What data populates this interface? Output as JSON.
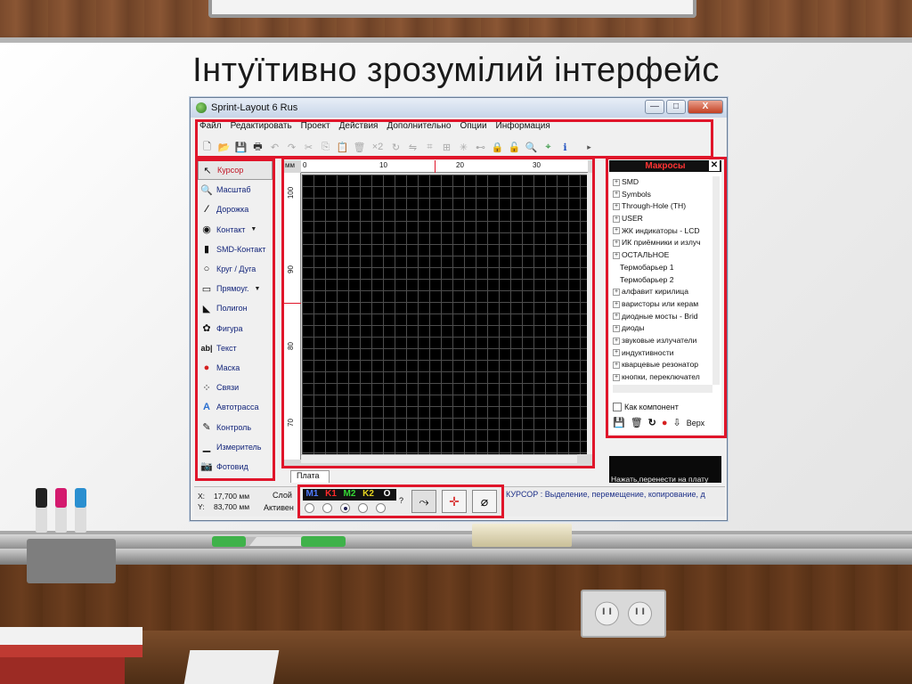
{
  "slide": {
    "title": "Інтуїтивно зрозумілий інтерфейс"
  },
  "window": {
    "title": "Sprint-Layout 6 Rus",
    "min_label": "—",
    "max_label": "□",
    "close_label": "X"
  },
  "menu": [
    "Файл",
    "Редактировать",
    "Проект",
    "Действия",
    "Дополнительно",
    "Опции",
    "Информация"
  ],
  "toolbar": {
    "new": "🗋",
    "open": "📂",
    "save": "💾",
    "print": "🖶",
    "undo": "↶",
    "redo": "↷",
    "cut": "✂",
    "copy": "⎘",
    "paste": "📋",
    "delete": "🗑",
    "x2": "×2",
    "rotate": "↻",
    "mirror": "⇋",
    "group": "⌗",
    "ungroup": "⊞",
    "light": "✳",
    "connect": "⊷",
    "lock": "🔒",
    "unlock": "🔓",
    "zoom": "🔍",
    "crop": "⌖",
    "info": "ℹ",
    "more": "▸"
  },
  "tools": [
    {
      "label": "Курсор",
      "icon": "↖"
    },
    {
      "label": "Масштаб",
      "icon": "🔍"
    },
    {
      "label": "Дорожка",
      "icon": "∕"
    },
    {
      "label": "Контакт",
      "icon": "◉",
      "caret": "▼"
    },
    {
      "label": "SMD-Контакт",
      "icon": "▮"
    },
    {
      "label": "Круг / Дуга",
      "icon": "○"
    },
    {
      "label": "Прямоуг.",
      "icon": "▭",
      "caret": "▼"
    },
    {
      "label": "Полигон",
      "icon": "◣"
    },
    {
      "label": "Фигура",
      "icon": "✿"
    },
    {
      "label": "Текст",
      "icon": "ab|"
    },
    {
      "label": "Маска",
      "icon": "●"
    },
    {
      "label": "Связи",
      "icon": "⁘"
    },
    {
      "label": "Автотрасса",
      "icon": "A"
    },
    {
      "label": "Контроль",
      "icon": "✎"
    },
    {
      "label": "Измеритель",
      "icon": "▁"
    },
    {
      "label": "Фотовид",
      "icon": "📷"
    }
  ],
  "ruler": {
    "unit": "мм",
    "top": [
      "0",
      "10",
      "20",
      "30"
    ],
    "left": [
      "100",
      "90",
      "80",
      "70"
    ]
  },
  "canvas_tab": "Плата",
  "macros": {
    "title": "Макросы",
    "close": "✕",
    "tree": [
      {
        "label": "SMD",
        "expand": "+"
      },
      {
        "label": "Symbols",
        "expand": "+"
      },
      {
        "label": "Through-Hole (TH)",
        "expand": "+"
      },
      {
        "label": "USER",
        "expand": "+"
      },
      {
        "label": "ЖК индикаторы - LCD",
        "expand": "+"
      },
      {
        "label": "ИК приёмники и излуч",
        "expand": "+"
      },
      {
        "label": "ОСТАЛЬНОЕ",
        "expand": "+"
      },
      {
        "label": "Термобарьер 1",
        "expand": ""
      },
      {
        "label": "Термобарьер 2",
        "expand": ""
      },
      {
        "label": "алфавит кирилица",
        "expand": "+"
      },
      {
        "label": "варисторы или керам",
        "expand": "+"
      },
      {
        "label": "диодные мосты - Brid",
        "expand": "+"
      },
      {
        "label": "диоды",
        "expand": "+"
      },
      {
        "label": "звуковые излучатели",
        "expand": "+"
      },
      {
        "label": "индуктивности",
        "expand": "+"
      },
      {
        "label": "кварцевые резонатор",
        "expand": "+"
      },
      {
        "label": "кнопки, переключател",
        "expand": "+"
      }
    ],
    "as_component": "Как компонент",
    "icons": {
      "save": "💾",
      "trash": "🗑",
      "refresh": "↻",
      "record": "●",
      "export": "⇩"
    },
    "top_label": "Верх"
  },
  "hint": "Нажать,перенести на плату",
  "status": {
    "x_label": "X:",
    "x_value": "17,700 мм",
    "y_label": "Y:",
    "y_value": "83,700 мм",
    "layer_label": "Слой",
    "active_label": "Активен",
    "layers": [
      {
        "name": "M1",
        "color": "#4f7bff"
      },
      {
        "name": "K1",
        "color": "#ff2a2a"
      },
      {
        "name": "M2",
        "color": "#35d935"
      },
      {
        "name": "K2",
        "color": "#e8d520"
      },
      {
        "name": "O",
        "color": "#ffffff"
      }
    ],
    "question": "?",
    "btn_route": "⤳",
    "btn_cross": "✛",
    "btn_drop": "⌀",
    "message": "КУРСОР : Выделение, перемещение, копирование, д"
  }
}
